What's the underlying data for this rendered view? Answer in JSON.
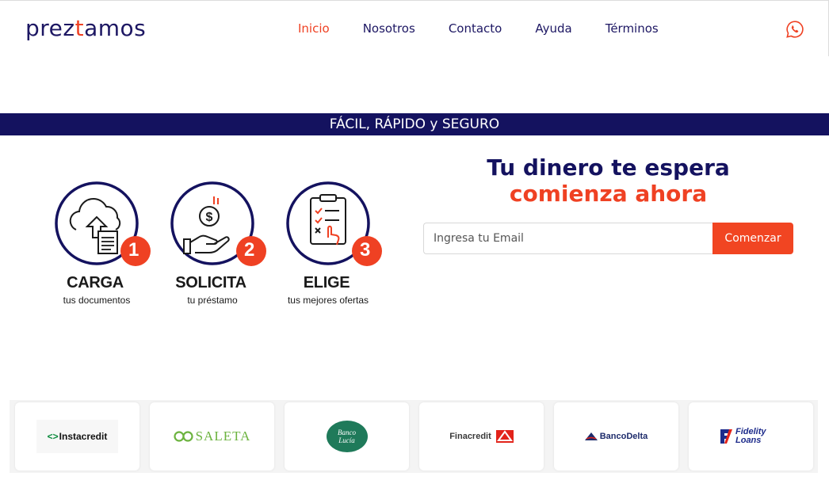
{
  "header": {
    "logo": {
      "part1": "prez",
      "part2": "t",
      "part3": "amos"
    },
    "nav": [
      "Inicio",
      "Nosotros",
      "Contacto",
      "Ayuda",
      "Términos"
    ],
    "active_nav": "Inicio",
    "contact_icon": "whatsapp-icon"
  },
  "banner": {
    "text": "FÁCIL, RÁPIDO y SEGURO"
  },
  "steps": [
    {
      "number": "1",
      "title": "CARGA",
      "subtitle": "tus documentos",
      "icon": "cloud-upload-document-icon"
    },
    {
      "number": "2",
      "title": "SOLICITA",
      "subtitle": "tu préstamo",
      "icon": "hand-coin-icon"
    },
    {
      "number": "3",
      "title": "ELIGE",
      "subtitle": "tus mejores ofertas",
      "icon": "clipboard-checklist-icon"
    }
  ],
  "hero": {
    "title": "Tu dinero te espera",
    "subtitle": "comienza ahora",
    "email_placeholder": "Ingresa tu Email",
    "email_value": "",
    "button_label": "Comenzar"
  },
  "partners": [
    {
      "name": "Instacredit"
    },
    {
      "name": "SALETA"
    },
    {
      "name": "Banco Lucía"
    },
    {
      "name": "Finacredit"
    },
    {
      "name": "BancoDelta"
    },
    {
      "name": "Fidelity Loans"
    }
  ],
  "colors": {
    "navy": "#14125f",
    "accent": "#ef4123"
  }
}
